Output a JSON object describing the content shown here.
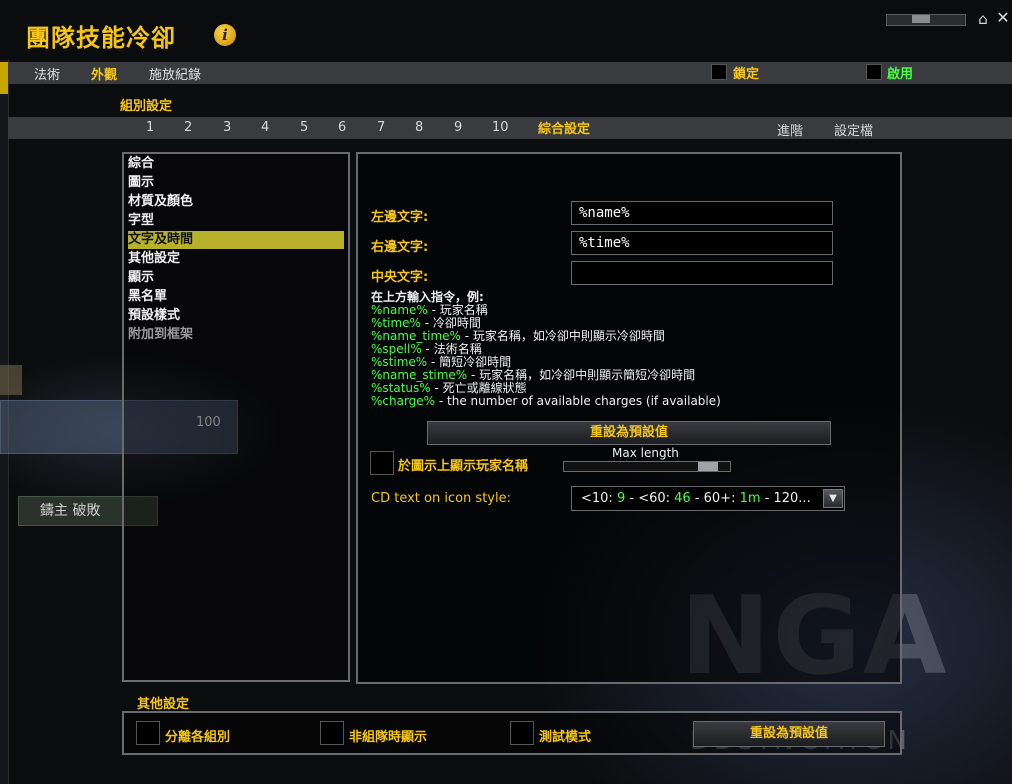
{
  "window": {
    "title": "團隊技能冷卻"
  },
  "menu": {
    "items": [
      "法術",
      "外觀",
      "施放紀錄"
    ],
    "active": "外觀",
    "lock_label": "鎖定",
    "enable_label": "啟用"
  },
  "group": {
    "label": "組別設定",
    "tabs": [
      "1",
      "2",
      "3",
      "4",
      "5",
      "6",
      "7",
      "8",
      "9",
      "10",
      "綜合設定"
    ],
    "active_tab": "綜合設定",
    "advanced": "進階",
    "profile": "設定檔"
  },
  "sidebar": {
    "items": [
      "綜合",
      "圖示",
      "材質及顏色",
      "字型",
      "文字及時間",
      "其他設定",
      "顯示",
      "黑名單",
      "預設樣式",
      "附加到框架"
    ],
    "selected": "文字及時間",
    "disabled": "附加到框架"
  },
  "text_settings": {
    "left_label": "左邊文字:",
    "left_value": "%name%",
    "right_label": "右邊文字:",
    "right_value": "%time%",
    "center_label": "中央文字:",
    "center_value": "",
    "help_intro": "在上方輸入指令，例:",
    "help": [
      {
        "code": "%name%",
        "desc": " - 玩家名稱"
      },
      {
        "code": "%time%",
        "desc": " - 冷卻時間"
      },
      {
        "code": "%name_time%",
        "desc": " - 玩家名稱，如冷卻中則顯示冷卻時間"
      },
      {
        "code": "%spell%",
        "desc": " - 法術名稱"
      },
      {
        "code": "%stime%",
        "desc": " - 簡短冷卻時間"
      },
      {
        "code": "%name_stime%",
        "desc": " - 玩家名稱，如冷卻中則顯示簡短冷卻時間"
      },
      {
        "code": "%status%",
        "desc": " - 死亡或離線狀態"
      },
      {
        "code": "%charge%",
        "desc": " - the number of available charges (if available)"
      }
    ],
    "reset_label": "重設為預設值",
    "show_name_label": "於圖示上顯示玩家名稱",
    "max_length_label": "Max length",
    "max_length_fraction": 0.92,
    "cd_style_label": "CD text on icon style:",
    "cd_style_parts": [
      "<10: ",
      "9",
      " - <60: ",
      "46",
      " - 60+: ",
      "1m",
      " - 120..."
    ]
  },
  "other": {
    "label": "其他設定",
    "split_groups": "分離各組別",
    "show_not_in_group": "非組隊時顯示",
    "test_mode": "測試模式",
    "reset_label": "重設為預設值"
  },
  "background": {
    "bar_value": "100",
    "bar_text": "鑄主 破敗"
  },
  "watermark": {
    "logo": "NGA",
    "site": "BBS.NGA.CN"
  },
  "colors": {
    "accent": "#f5c518",
    "code_green": "#44ff44",
    "selected_bg": "#b7b22a"
  }
}
